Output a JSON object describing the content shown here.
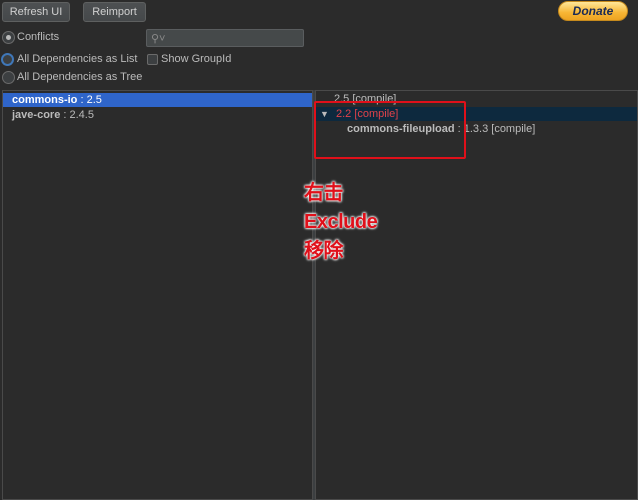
{
  "toolbar": {
    "refresh_label": "Refresh UI",
    "reimport_label": "Reimport",
    "donate_label": "Donate",
    "search": {
      "value": "",
      "placeholder": ""
    }
  },
  "view_options": {
    "conflicts": "Conflicts",
    "all_list": "All Dependencies as List",
    "all_tree": "All Dependencies as Tree",
    "show_group_id": "Show GroupId"
  },
  "left_list": [
    {
      "name": "commons-io",
      "version": ": 2.5"
    },
    {
      "name": "jave-core",
      "version": ": 2.4.5"
    }
  ],
  "right_tree": {
    "item1": "2.5 [compile]",
    "expand_glyph": "▼",
    "item2": "2.2 [compile]",
    "child_name": "commons-fileupload",
    "child_version": ": 1.3.3 [compile]"
  },
  "annotation": {
    "line1": "右击",
    "line2": "Exclude",
    "line3": "移除",
    "color": "#e0101a"
  },
  "colors": {
    "selection": "#2f65ca",
    "highlight_row": "#0d293e",
    "conflict_red": "#e0424a",
    "donate_gold": "#f7b533"
  }
}
